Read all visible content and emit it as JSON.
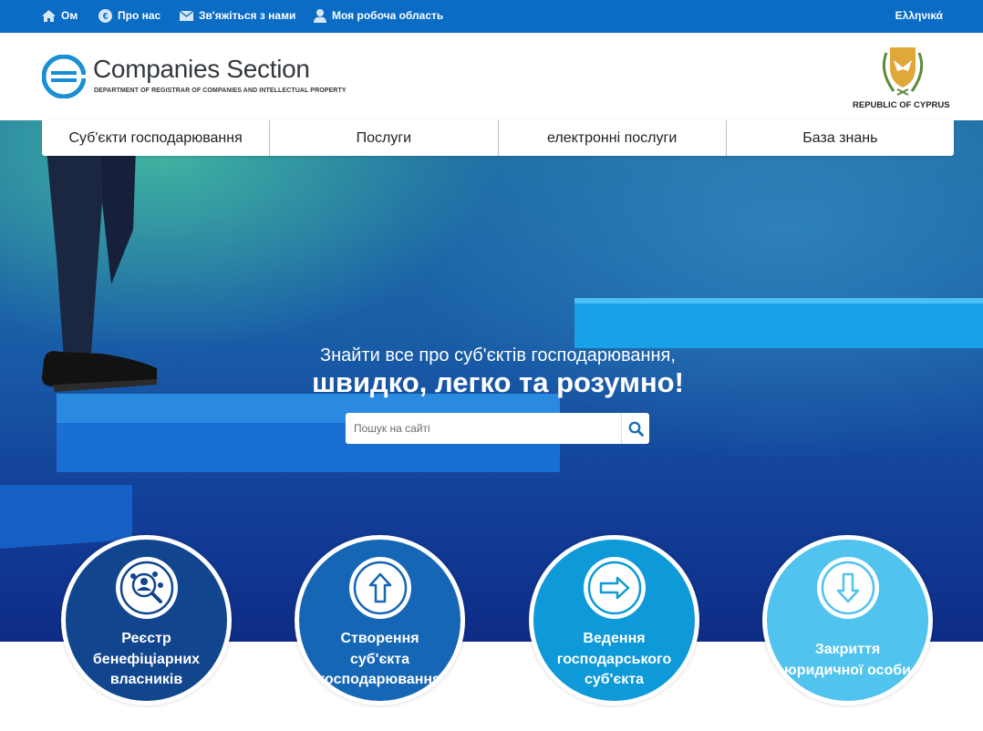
{
  "topbar": {
    "home_label": "Ом",
    "about_label": "Про нас",
    "contact_label": "Зв'яжіться з нами",
    "workspace_label": "Моя робоча область",
    "language_label": "Ελληνικά"
  },
  "header": {
    "logo_title": "Companies Section",
    "logo_subtitle": "DEPARTMENT OF REGISTRAR OF COMPANIES AND INTELLECTUAL PROPERTY",
    "emblem_text": "REPUBLIC OF CYPRUS"
  },
  "nav": {
    "items": [
      {
        "label": "Суб'єкти господарювання"
      },
      {
        "label": "Послуги"
      },
      {
        "label": "електронні послуги"
      },
      {
        "label": "База знань"
      }
    ]
  },
  "hero": {
    "line1": "Знайти все про суб'єктів господарювання,",
    "line2": "швидко, легко та розумно!",
    "search_placeholder": "Пошук на сайті"
  },
  "circles": [
    {
      "label_lines": [
        "Реєстр",
        "бенефіціарних",
        "власників"
      ],
      "icon": "people-search-icon",
      "color": "#11458e"
    },
    {
      "label_lines": [
        "Створення",
        "суб'єкта",
        "господарювання"
      ],
      "icon": "arrow-up-icon",
      "color": "#1566b5"
    },
    {
      "label_lines": [
        "Ведення",
        "господарського",
        "суб'єкта"
      ],
      "icon": "arrow-right-icon",
      "color": "#0e99d8"
    },
    {
      "label_lines": [
        "Закриття",
        "юридичної особи"
      ],
      "icon": "arrow-down-icon",
      "color": "#50c3ee"
    }
  ],
  "colors": {
    "topbar": "#0a6cc4",
    "accent": "#1a8fd6"
  }
}
